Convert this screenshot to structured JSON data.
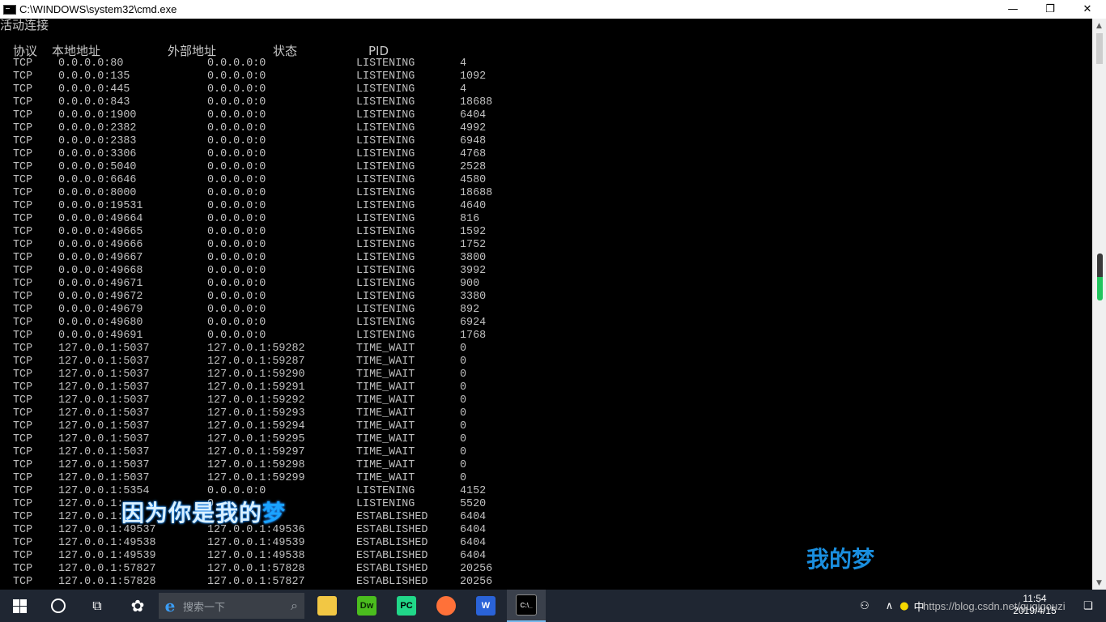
{
  "window": {
    "title": "C:\\WINDOWS\\system32\\cmd.exe",
    "minimize": "—",
    "maximize": "❐",
    "close": "✕"
  },
  "console": {
    "section_title": "活动连接",
    "headers": {
      "proto": "协议",
      "local": "本地地址",
      "foreign": "外部地址",
      "state": "状态",
      "pid": "PID"
    },
    "rows": [
      [
        "TCP",
        "0.0.0.0:80",
        "0.0.0.0:0",
        "LISTENING",
        "4"
      ],
      [
        "TCP",
        "0.0.0.0:135",
        "0.0.0.0:0",
        "LISTENING",
        "1092"
      ],
      [
        "TCP",
        "0.0.0.0:445",
        "0.0.0.0:0",
        "LISTENING",
        "4"
      ],
      [
        "TCP",
        "0.0.0.0:843",
        "0.0.0.0:0",
        "LISTENING",
        "18688"
      ],
      [
        "TCP",
        "0.0.0.0:1900",
        "0.0.0.0:0",
        "LISTENING",
        "6404"
      ],
      [
        "TCP",
        "0.0.0.0:2382",
        "0.0.0.0:0",
        "LISTENING",
        "4992"
      ],
      [
        "TCP",
        "0.0.0.0:2383",
        "0.0.0.0:0",
        "LISTENING",
        "6948"
      ],
      [
        "TCP",
        "0.0.0.0:3306",
        "0.0.0.0:0",
        "LISTENING",
        "4768"
      ],
      [
        "TCP",
        "0.0.0.0:5040",
        "0.0.0.0:0",
        "LISTENING",
        "2528"
      ],
      [
        "TCP",
        "0.0.0.0:6646",
        "0.0.0.0:0",
        "LISTENING",
        "4580"
      ],
      [
        "TCP",
        "0.0.0.0:8000",
        "0.0.0.0:0",
        "LISTENING",
        "18688"
      ],
      [
        "TCP",
        "0.0.0.0:19531",
        "0.0.0.0:0",
        "LISTENING",
        "4640"
      ],
      [
        "TCP",
        "0.0.0.0:49664",
        "0.0.0.0:0",
        "LISTENING",
        "816"
      ],
      [
        "TCP",
        "0.0.0.0:49665",
        "0.0.0.0:0",
        "LISTENING",
        "1592"
      ],
      [
        "TCP",
        "0.0.0.0:49666",
        "0.0.0.0:0",
        "LISTENING",
        "1752"
      ],
      [
        "TCP",
        "0.0.0.0:49667",
        "0.0.0.0:0",
        "LISTENING",
        "3800"
      ],
      [
        "TCP",
        "0.0.0.0:49668",
        "0.0.0.0:0",
        "LISTENING",
        "3992"
      ],
      [
        "TCP",
        "0.0.0.0:49671",
        "0.0.0.0:0",
        "LISTENING",
        "900"
      ],
      [
        "TCP",
        "0.0.0.0:49672",
        "0.0.0.0:0",
        "LISTENING",
        "3380"
      ],
      [
        "TCP",
        "0.0.0.0:49679",
        "0.0.0.0:0",
        "LISTENING",
        "892"
      ],
      [
        "TCP",
        "0.0.0.0:49680",
        "0.0.0.0:0",
        "LISTENING",
        "6924"
      ],
      [
        "TCP",
        "0.0.0.0:49691",
        "0.0.0.0:0",
        "LISTENING",
        "1768"
      ],
      [
        "TCP",
        "127.0.0.1:5037",
        "127.0.0.1:59282",
        "TIME_WAIT",
        "0"
      ],
      [
        "TCP",
        "127.0.0.1:5037",
        "127.0.0.1:59287",
        "TIME_WAIT",
        "0"
      ],
      [
        "TCP",
        "127.0.0.1:5037",
        "127.0.0.1:59290",
        "TIME_WAIT",
        "0"
      ],
      [
        "TCP",
        "127.0.0.1:5037",
        "127.0.0.1:59291",
        "TIME_WAIT",
        "0"
      ],
      [
        "TCP",
        "127.0.0.1:5037",
        "127.0.0.1:59292",
        "TIME_WAIT",
        "0"
      ],
      [
        "TCP",
        "127.0.0.1:5037",
        "127.0.0.1:59293",
        "TIME_WAIT",
        "0"
      ],
      [
        "TCP",
        "127.0.0.1:5037",
        "127.0.0.1:59294",
        "TIME_WAIT",
        "0"
      ],
      [
        "TCP",
        "127.0.0.1:5037",
        "127.0.0.1:59295",
        "TIME_WAIT",
        "0"
      ],
      [
        "TCP",
        "127.0.0.1:5037",
        "127.0.0.1:59297",
        "TIME_WAIT",
        "0"
      ],
      [
        "TCP",
        "127.0.0.1:5037",
        "127.0.0.1:59298",
        "TIME_WAIT",
        "0"
      ],
      [
        "TCP",
        "127.0.0.1:5037",
        "127.0.0.1:59299",
        "TIME_WAIT",
        "0"
      ],
      [
        "TCP",
        "127.0.0.1:5354",
        "0.0.0.0:0",
        "LISTENING",
        "4152"
      ],
      [
        "TCP",
        "127.0.0.1:",
        "0",
        "LISTENING",
        "5520"
      ],
      [
        "TCP",
        "127.0.0.1:",
        "7",
        "ESTABLISHED",
        "6404"
      ],
      [
        "TCP",
        "127.0.0.1:49537",
        "127.0.0.1:49536",
        "ESTABLISHED",
        "6404"
      ],
      [
        "TCP",
        "127.0.0.1:49538",
        "127.0.0.1:49539",
        "ESTABLISHED",
        "6404"
      ],
      [
        "TCP",
        "127.0.0.1:49539",
        "127.0.0.1:49538",
        "ESTABLISHED",
        "6404"
      ],
      [
        "TCP",
        "127.0.0.1:57827",
        "127.0.0.1:57828",
        "ESTABLISHED",
        "20256"
      ],
      [
        "TCP",
        "127.0.0.1:57828",
        "127.0.0.1:57827",
        "ESTABLISHED",
        "20256"
      ]
    ]
  },
  "overlays": {
    "subtitle_main": "因为你是我的",
    "subtitle_last": "梦",
    "caption": "我的梦"
  },
  "taskbar": {
    "search_placeholder": "搜索一下",
    "pins": [
      {
        "name": "file-explorer",
        "label": "",
        "color": "#f2c744"
      },
      {
        "name": "dreamweaver",
        "label": "Dw",
        "color": "#4bbd1e"
      },
      {
        "name": "pycharm",
        "label": "PC",
        "color": "#21d789"
      },
      {
        "name": "firefox",
        "label": "",
        "color": "#ff7139"
      },
      {
        "name": "wps",
        "label": "W",
        "color": "#2a63d8"
      },
      {
        "name": "cmd",
        "label": "C:\\_",
        "color": "#000000"
      }
    ],
    "tray_text": "中",
    "watermark": "https://blog.csdn.net/guqigouzi",
    "clock_time": "11:54",
    "clock_date": "2019/4/15"
  }
}
